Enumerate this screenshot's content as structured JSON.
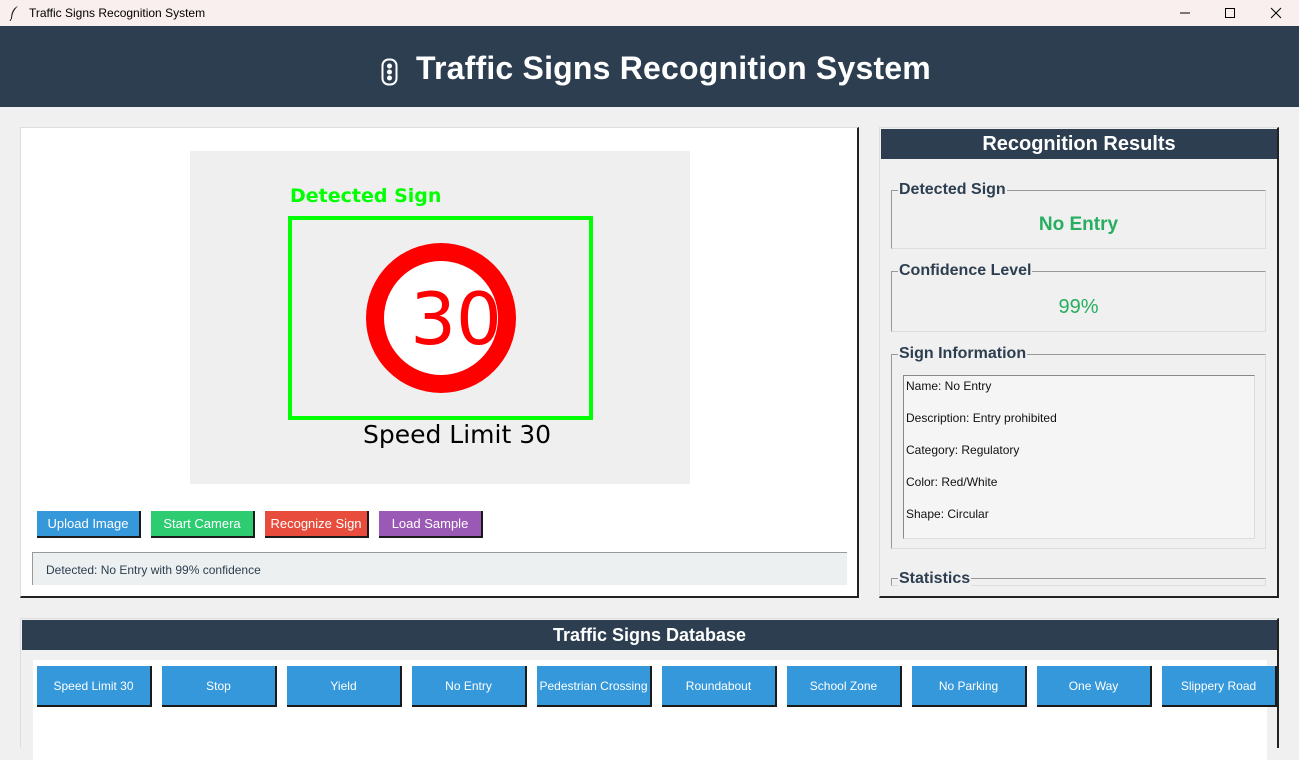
{
  "window": {
    "title": "Traffic Signs Recognition System",
    "controls": [
      "minimize",
      "maximize",
      "close"
    ]
  },
  "header": {
    "title": "Traffic Signs Recognition System",
    "icon": "traffic-light-icon"
  },
  "preview": {
    "detection_label": "Detected Sign",
    "sign_number": "30",
    "caption": "Speed Limit 30",
    "colors": {
      "box": "#00ff00",
      "ring": "#ff0000",
      "background": "#efefef"
    }
  },
  "actions": {
    "upload": "Upload Image",
    "camera": "Start Camera",
    "recognize": "Recognize Sign",
    "sample": "Load Sample"
  },
  "status": "Detected: No Entry with 99% confidence",
  "results": {
    "title": "Recognition Results",
    "detected_label": "Detected Sign",
    "detected_value": "No Entry",
    "confidence_label": "Confidence Level",
    "confidence_value": "99%",
    "info_label": "Sign Information",
    "info_lines": [
      "Name: No Entry",
      "Description: Entry prohibited",
      "Category: Regulatory",
      "Color: Red/White",
      "Shape: Circular"
    ],
    "stats_label": "Statistics"
  },
  "database": {
    "title": "Traffic Signs Database",
    "signs": [
      "Speed Limit 30",
      "Stop",
      "Yield",
      "No Entry",
      "Pedestrian Crossing",
      "Roundabout",
      "School Zone",
      "No Parking",
      "One Way",
      "Slippery Road"
    ]
  },
  "colors": {
    "header_bg": "#2c3e50",
    "upload": "#3498db",
    "camera": "#2ecc71",
    "recognize": "#e74c3c",
    "sample": "#9b59b6",
    "result_text": "#27ae60"
  }
}
